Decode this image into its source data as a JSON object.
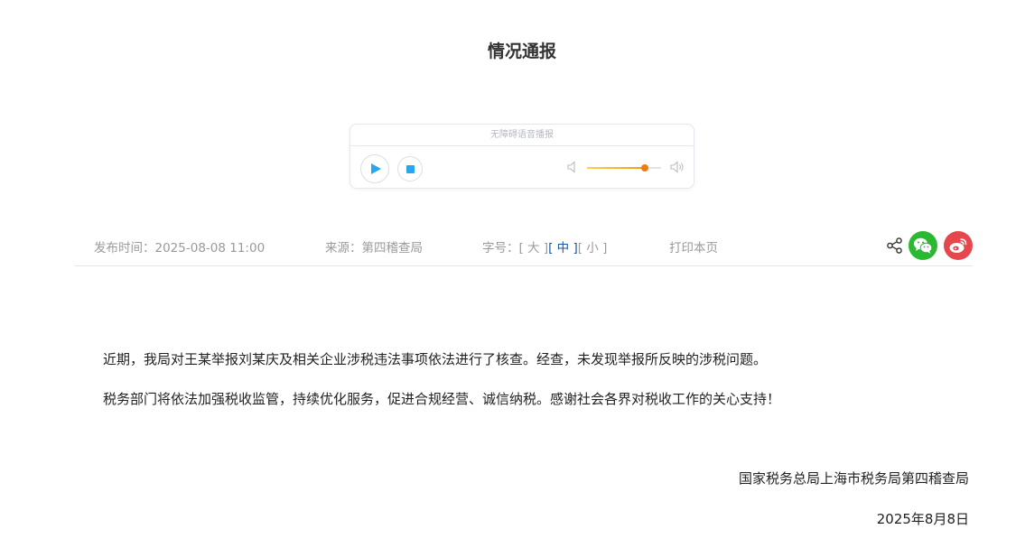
{
  "article": {
    "title": "情况通报",
    "paragraphs": [
      "近期，我局对王某举报刘某庆及相关企业涉税违法事项依法进行了核查。经查，未发现举报所反映的涉税问题。",
      "税务部门将依法加强税收监管，持续优化服务，促进合规经营、诚信纳税。感谢社会各界对税收工作的关心支持！"
    ],
    "signature": "国家税务总局上海市税务局第四稽查局",
    "date": "2025年8月8日"
  },
  "player": {
    "header": "无障碍语音播报",
    "volume_percent": 78
  },
  "meta": {
    "publish_label": "发布时间：",
    "publish_time": "2025-08-08 11:00",
    "source_label": "来源：",
    "source": "第四稽查局",
    "font_label": "字号：",
    "font_large": "[ 大 ]",
    "font_medium": "[ 中 ]",
    "font_small": "[ 小 ]",
    "font_selected": "medium",
    "print": "打印本页"
  },
  "share": {
    "icons": [
      "share-icon",
      "wechat-icon",
      "weibo-icon"
    ],
    "colors": {
      "wechat": "#2bb832",
      "weibo": "#e5474d",
      "accent": "#29a7ee"
    }
  }
}
